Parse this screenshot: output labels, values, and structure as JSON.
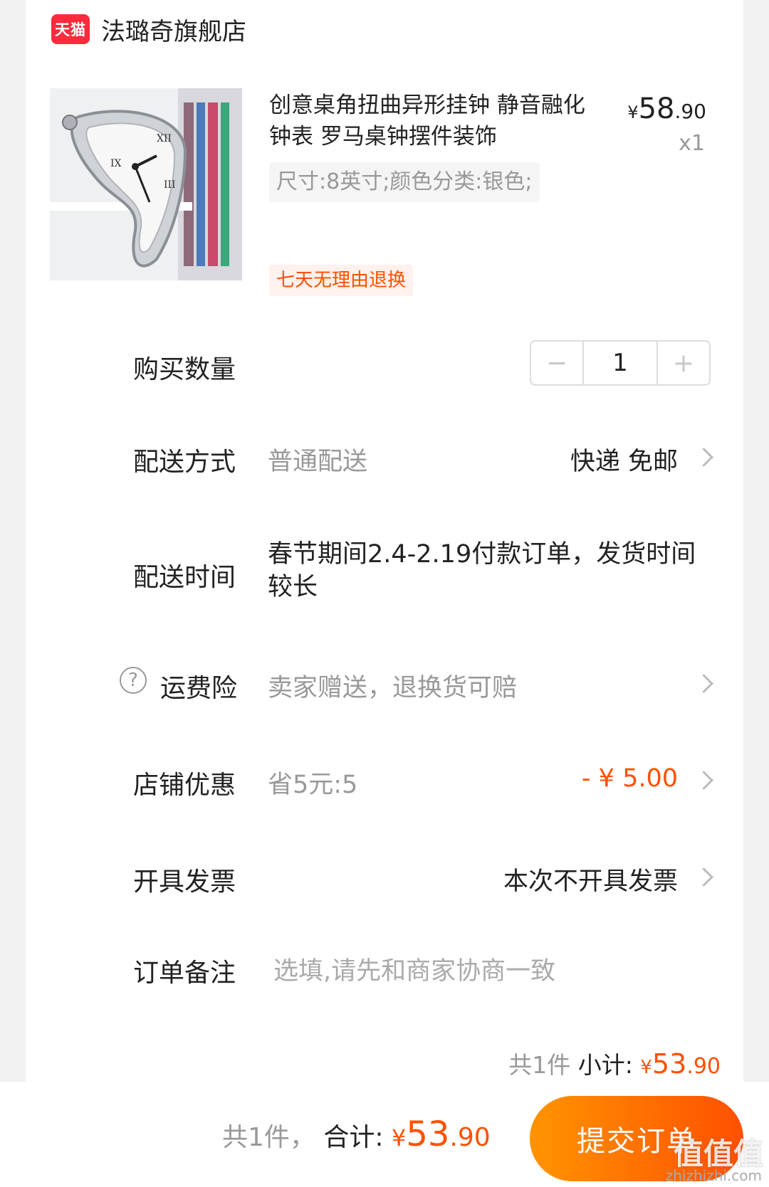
{
  "shop": {
    "badge": "天猫",
    "name": "法璐奇旗舰店"
  },
  "product": {
    "title": "创意桌角扭曲异形挂钟 静音融化钟表 罗马桌钟摆件装饰",
    "spec": "尺寸:8英寸;颜色分类:银色;",
    "tag": "七天无理由退换",
    "price_symbol": "¥",
    "price_int": "58",
    "price_dec": ".90",
    "qty_label": "x1"
  },
  "quantity": {
    "label": "购买数量",
    "minus": "−",
    "value": "1",
    "plus": "+"
  },
  "delivery": {
    "label": "配送方式",
    "value": "普通配送",
    "detail": "快递 免邮"
  },
  "delivery_time": {
    "label": "配送时间",
    "value": "春节期间2.4-2.19付款订单，发货时间较长"
  },
  "insurance": {
    "icon": "?",
    "label": "运费险",
    "value": "卖家赠送，退换货可赔"
  },
  "discount": {
    "label": "店铺优惠",
    "value": "省5元:5",
    "amount": "- ¥ 5.00"
  },
  "invoice": {
    "label": "开具发票",
    "value": "本次不开具发票"
  },
  "note": {
    "label": "订单备注",
    "placeholder": "选填,请先和商家协商一致"
  },
  "subtotal": {
    "count": "共1件",
    "label": "小计:",
    "symbol": "¥",
    "int": "53",
    "dec": ".90"
  },
  "footer": {
    "count": "共1件，",
    "total_label": "合计:",
    "symbol": "¥",
    "int": "53",
    "dec": ".90",
    "submit": "提交订单",
    "watermark": "值值值",
    "watermark_url": "zhizhizhi.com"
  },
  "colors": {
    "accent": "#ff5000",
    "tmall_red": "#ff2a3c",
    "gray_text": "#999999"
  }
}
